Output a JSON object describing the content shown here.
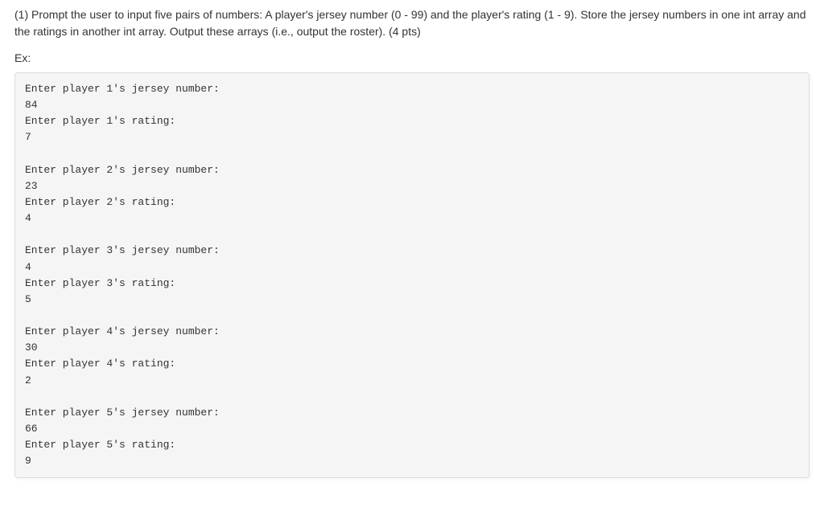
{
  "instructions": "(1) Prompt the user to input five pairs of numbers: A player's jersey number (0 - 99) and the player's rating (1 - 9). Store the jersey numbers in one int array and the ratings in another int array. Output these arrays (i.e., output the roster). (4 pts)",
  "example_label": "Ex:",
  "code_output": "Enter player 1's jersey number:\n84\nEnter player 1's rating:\n7\n\nEnter player 2's jersey number:\n23\nEnter player 2's rating:\n4\n\nEnter player 3's jersey number:\n4\nEnter player 3's rating:\n5\n\nEnter player 4's jersey number:\n30\nEnter player 4's rating:\n2\n\nEnter player 5's jersey number:\n66\nEnter player 5's rating:\n9"
}
